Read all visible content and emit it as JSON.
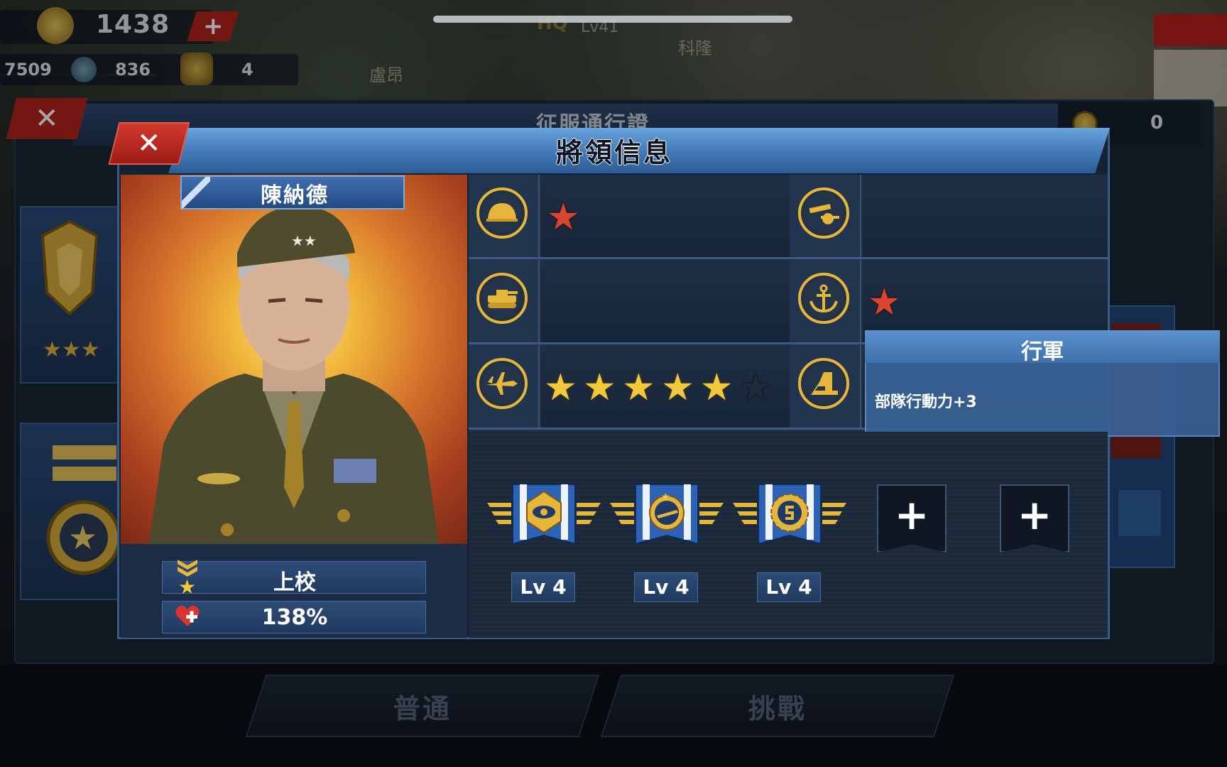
{
  "map": {
    "labels": [
      "盧昂",
      "科隆"
    ],
    "hq_text": "HQ",
    "level_text": "Lv41"
  },
  "resources": {
    "gold": "1438",
    "add_label": "+",
    "res_a": "7509",
    "res_b": "836",
    "res_c": "4"
  },
  "back_panel": {
    "title": "征服通行證",
    "close_label": "✕",
    "count": "0"
  },
  "bottom_tabs": [
    "普通",
    "挑戰"
  ],
  "dialog": {
    "title": "將領信息",
    "close_label": "✕"
  },
  "general": {
    "name": "陳納德",
    "rank": "上校",
    "health": "138%"
  },
  "skills": [
    {
      "icon": "infantry-helmet-icon",
      "stars_filled": 1,
      "stars_total": 1,
      "color": "#d9452e"
    },
    {
      "icon": "artillery-cannon-icon",
      "stars_filled": 0,
      "stars_total": 0,
      "color": ""
    },
    {
      "icon": "tank-icon",
      "stars_filled": 0,
      "stars_total": 0,
      "color": ""
    },
    {
      "icon": "navy-anchor-icon",
      "stars_filled": 1,
      "stars_total": 1,
      "color": "#d9452e"
    },
    {
      "icon": "airforce-plane-icon",
      "stars_filled": 5,
      "stars_total": 6,
      "color": "#f3c93b"
    },
    {
      "icon": "march-boot-icon",
      "stars_filled": 0,
      "stars_total": 0,
      "color": ""
    }
  ],
  "tooltip": {
    "title": "行軍",
    "description": "部隊行動力+3"
  },
  "medals": [
    {
      "icon": "eye-medal-icon",
      "level": "Lv 4"
    },
    {
      "icon": "plane-medal-icon",
      "level": "Lv 4"
    },
    {
      "icon": "gear-medal-icon",
      "level": "Lv 4"
    }
  ],
  "empty_slots": [
    "+",
    "+"
  ],
  "colors": {
    "accent_blue": "#3f78b6",
    "close_red": "#b3241e",
    "star_gold": "#f3c93b",
    "star_red": "#d9452e",
    "icon_gold": "#e6b63a"
  }
}
